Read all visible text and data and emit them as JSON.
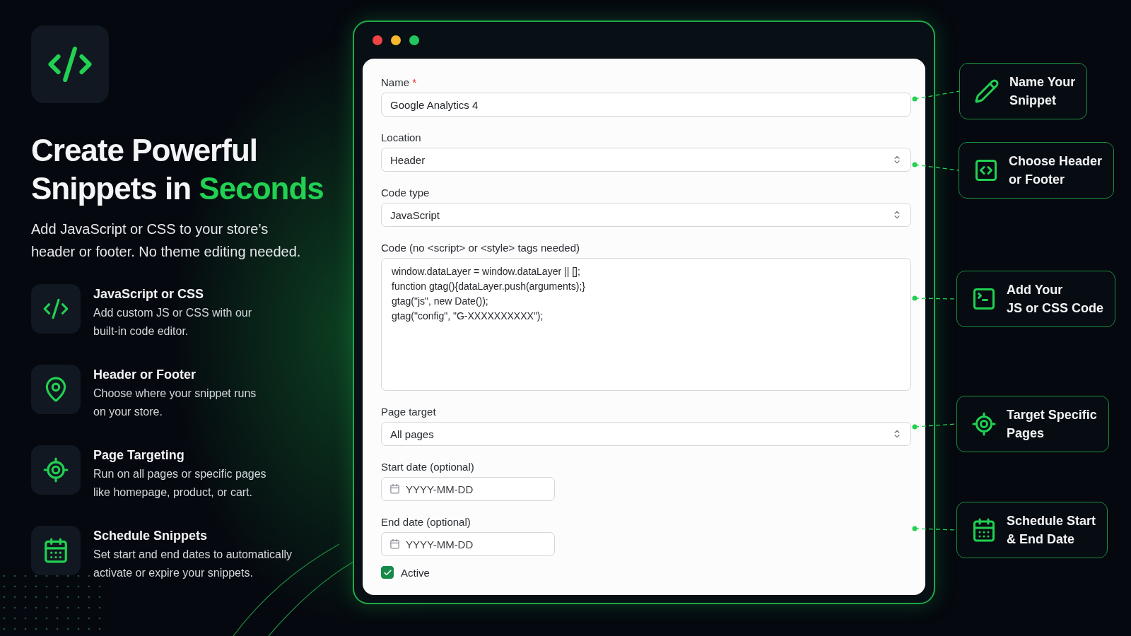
{
  "hero": {
    "title": "Create Powerful Snippets in",
    "title_highlight": "Seconds",
    "subtitle_lines": [
      "Add JavaScript or CSS to your store’s",
      "header or footer. No theme editing needed."
    ]
  },
  "features": [
    {
      "title": "JavaScript or CSS",
      "desc_lines": [
        "Add custom JS or CSS with our",
        "built-in code editor."
      ]
    },
    {
      "title": "Header or Footer",
      "desc_lines": [
        "Choose where your snippet runs",
        "on your store."
      ]
    },
    {
      "title": "Page Targeting",
      "desc_lines": [
        "Run on all pages or specific pages",
        "like homepage, product, or cart."
      ]
    },
    {
      "title": "Schedule Snippets",
      "desc_lines": [
        "Set start and end dates to automatically",
        "activate or expire your snippets."
      ]
    }
  ],
  "form": {
    "fields": [
      {
        "kind": "text",
        "label": "Name",
        "required_mark": "*",
        "value": "Google Analytics 4"
      },
      {
        "kind": "select",
        "label": "Location",
        "value": "Header"
      },
      {
        "kind": "select",
        "label": "Code type",
        "value": "JavaScript"
      },
      {
        "kind": "code",
        "label": "Code (no <script> or <style> tags needed)",
        "value": "window.dataLayer = window.dataLayer || [];\nfunction gtag(){dataLayer.push(arguments);}\ngtag(\"js\", new Date());\ngtag(\"config\", \"G-XXXXXXXXXX\");"
      },
      {
        "kind": "select",
        "label": "Page target",
        "value": "All pages"
      },
      {
        "kind": "date",
        "label": "Start date (optional)",
        "placeholder": "YYYY-MM-DD"
      },
      {
        "kind": "date",
        "label": "End date (optional)",
        "placeholder": "YYYY-MM-DD"
      },
      {
        "kind": "checkbox",
        "label": "Active",
        "checked": true
      }
    ]
  },
  "callouts": [
    {
      "lines": [
        "Name Your",
        "Snippet"
      ]
    },
    {
      "lines": [
        "Choose Header",
        "or Footer"
      ]
    },
    {
      "lines": [
        "Add Your",
        "JS or CSS Code"
      ]
    },
    {
      "lines": [
        "Target Specific",
        "Pages"
      ]
    },
    {
      "lines": [
        "Schedule Start",
        "& End Date"
      ]
    }
  ]
}
